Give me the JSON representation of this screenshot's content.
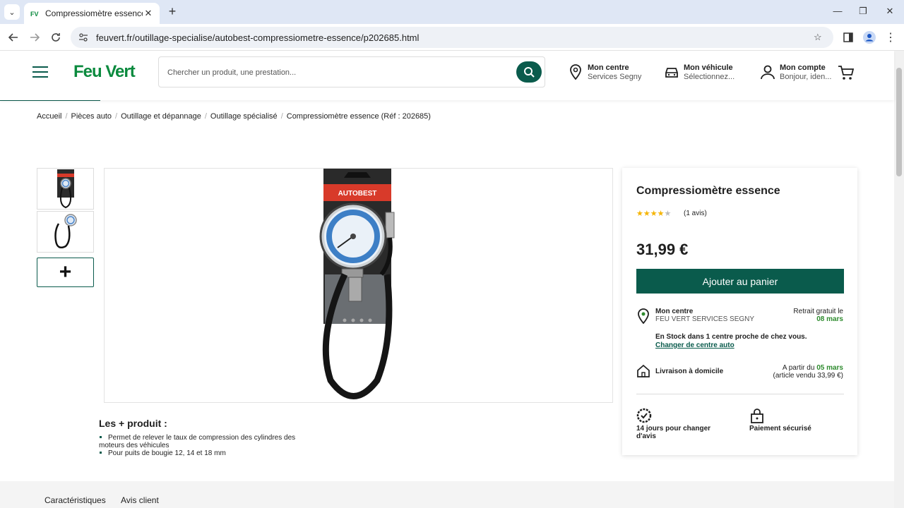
{
  "browser": {
    "tab_title": "Compressiomètre essence - Feu",
    "url": "feuvert.fr/outillage-specialise/autobest-compressiometre-essence/p202685.html"
  },
  "header": {
    "logo": "Feu Vert",
    "search_placeholder": "Chercher un produit, une prestation...",
    "centre": {
      "title": "Mon centre",
      "subtitle": "Services Segny"
    },
    "vehicule": {
      "title": "Mon véhicule",
      "subtitle": "Sélectionnez..."
    },
    "compte": {
      "title": "Mon compte",
      "subtitle": "Bonjour, iden..."
    }
  },
  "breadcrumb": [
    "Accueil",
    "Pièces auto",
    "Outillage et dépannage",
    "Outillage spécialisé",
    "Compressiomètre essence (Réf : 202685)"
  ],
  "gallery": {
    "thumbnails": [
      "gauge-packaged-thumb",
      "gauge-hose-thumb"
    ],
    "more_symbol": "+",
    "brand_label": "AUTOBEST"
  },
  "product": {
    "title": "Compressiomètre essence",
    "rating": 4,
    "rating_max": 5,
    "reviews": "(1 avis)",
    "price": "31,99 €",
    "add_to_cart": "Ajouter au panier",
    "centre_title": "Mon centre",
    "centre_name": "FEU VERT SERVICES SEGNY",
    "retrait_label": "Retrait gratuit le",
    "retrait_date": "08 mars",
    "stock": "En Stock dans 1 centre proche de chez vous.",
    "change_centre": "Changer de centre auto",
    "livraison": "Livraison à domicile",
    "apartir_label": "A partir du",
    "apartir_date": "05 mars",
    "article_price": "(article vendu 33,99 €)",
    "badge_return": "14 jours pour changer d'avis",
    "badge_payment": "Paiement sécurisé"
  },
  "highlights": {
    "title": "Les + produit :",
    "items": [
      "Permet de relever le taux de compression des cylindres des moteurs des véhicules",
      "Pour puits de bougie 12, 14 et 18 mm"
    ]
  },
  "tabs": [
    "Caractéristiques",
    "Avis client"
  ],
  "colors": {
    "brand": "#0a5b4c",
    "logo": "#0b8a3e",
    "star": "#f5b400",
    "date": "#2e8b2e"
  }
}
